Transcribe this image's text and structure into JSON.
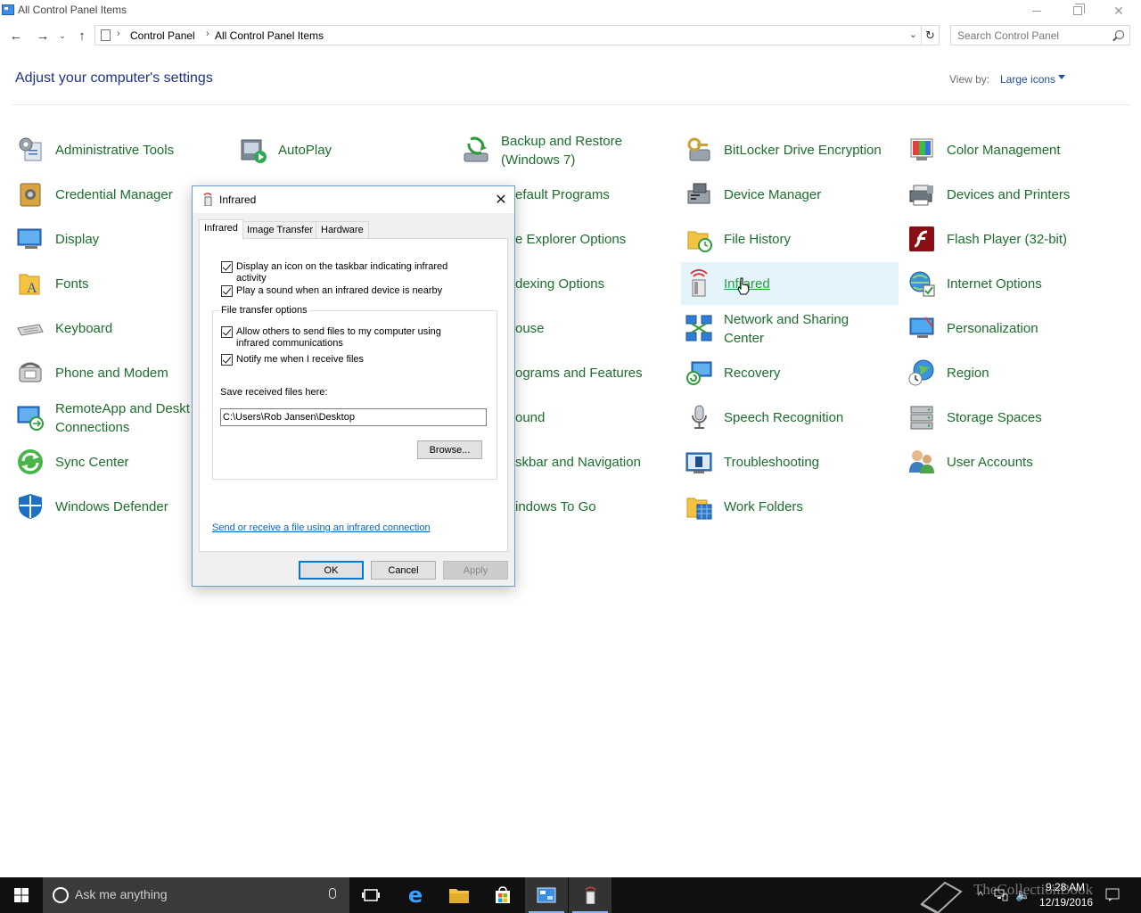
{
  "window": {
    "title": "All Control Panel Items",
    "accent": "#0078d7"
  },
  "address": {
    "crumbs": [
      "Control Panel",
      "All Control Panel Items"
    ],
    "search_placeholder": "Search Control Panel"
  },
  "header": {
    "title": "Adjust your computer's settings",
    "view_by_label": "View by:",
    "view_by_value": "Large icons"
  },
  "items": [
    {
      "line1": "Administrative Tools",
      "line2": "",
      "icon": "administrative-tools-icon"
    },
    {
      "line1": "AutoPlay",
      "line2": "",
      "icon": "autoplay-icon"
    },
    {
      "line1": "Backup and Restore",
      "line2": "(Windows 7)",
      "icon": "backup-restore-icon"
    },
    {
      "line1": "BitLocker Drive Encryption",
      "line2": "",
      "icon": "bitlocker-icon"
    },
    {
      "line1": "Color Management",
      "line2": "",
      "icon": "color-management-icon"
    },
    {
      "line1": "Credential Manager",
      "line2": "",
      "icon": "credential-manager-icon"
    },
    {
      "line1": "efault Programs",
      "line2": "",
      "icon": ""
    },
    {
      "line1": "Device Manager",
      "line2": "",
      "icon": "device-manager-icon"
    },
    {
      "line1": "Devices and Printers",
      "line2": "",
      "icon": "devices-printers-icon"
    },
    {
      "line1": "Display",
      "line2": "",
      "icon": "display-icon"
    },
    {
      "line1": "e Explorer Options",
      "line2": "",
      "icon": ""
    },
    {
      "line1": "File History",
      "line2": "",
      "icon": "file-history-icon"
    },
    {
      "line1": "Flash Player (32-bit)",
      "line2": "",
      "icon": "flash-player-icon"
    },
    {
      "line1": "Fonts",
      "line2": "",
      "icon": "fonts-icon"
    },
    {
      "line1": "dexing Options",
      "line2": "",
      "icon": ""
    },
    {
      "line1": "Infrared",
      "line2": "",
      "icon": "infrared-icon"
    },
    {
      "line1": "Internet Options",
      "line2": "",
      "icon": "internet-options-icon"
    },
    {
      "line1": "Keyboard",
      "line2": "",
      "icon": "keyboard-icon"
    },
    {
      "line1": "ouse",
      "line2": "",
      "icon": ""
    },
    {
      "line1": "Network and Sharing",
      "line2": "Center",
      "icon": "network-sharing-icon"
    },
    {
      "line1": "Personalization",
      "line2": "",
      "icon": "personalization-icon"
    },
    {
      "line1": "Phone and Modem",
      "line2": "",
      "icon": "phone-modem-icon"
    },
    {
      "line1": "ograms and Features",
      "line2": "",
      "icon": ""
    },
    {
      "line1": "Recovery",
      "line2": "",
      "icon": "recovery-icon"
    },
    {
      "line1": "Region",
      "line2": "",
      "icon": "region-icon"
    },
    {
      "line1": "RemoteApp and Deskt",
      "line2": "Connections",
      "icon": "remoteapp-icon"
    },
    {
      "line1": "ound",
      "line2": "",
      "icon": ""
    },
    {
      "line1": "Speech Recognition",
      "line2": "",
      "icon": "speech-recognition-icon"
    },
    {
      "line1": "Storage Spaces",
      "line2": "",
      "icon": "storage-spaces-icon"
    },
    {
      "line1": "Sync Center",
      "line2": "",
      "icon": "sync-center-icon"
    },
    {
      "line1": "skbar and Navigation",
      "line2": "",
      "icon": ""
    },
    {
      "line1": "Troubleshooting",
      "line2": "",
      "icon": "troubleshooting-icon"
    },
    {
      "line1": "User Accounts",
      "line2": "",
      "icon": "user-accounts-icon"
    },
    {
      "line1": "Windows Defender",
      "line2": "",
      "icon": "windows-defender-icon"
    },
    {
      "line1": "indows To Go",
      "line2": "",
      "icon": ""
    },
    {
      "line1": "Work Folders",
      "line2": "",
      "icon": "work-folders-icon"
    }
  ],
  "dialog": {
    "title": "Infrared",
    "tabs": [
      "Infrared",
      "Image Transfer",
      "Hardware"
    ],
    "active_tab": "Infrared",
    "check_taskbar": "Display an icon on the taskbar indicating infrared activity",
    "check_sound": "Play a sound when an infrared device is nearby",
    "group_label": "File transfer options",
    "check_allow": "Allow others to send files to my computer using infrared communications",
    "check_notify": "Notify me when I receive files",
    "save_label": "Save received files here:",
    "save_path": "C:\\Users\\Rob Jansen\\Desktop",
    "browse": "Browse...",
    "link": "Send or receive a file using an infrared connection",
    "ok": "OK",
    "cancel": "Cancel",
    "apply": "Apply"
  },
  "taskbar": {
    "search_text": "Ask me anything",
    "time": "9:28 AM",
    "date": "12/19/2016",
    "watermark": "TheCollectionBook"
  }
}
